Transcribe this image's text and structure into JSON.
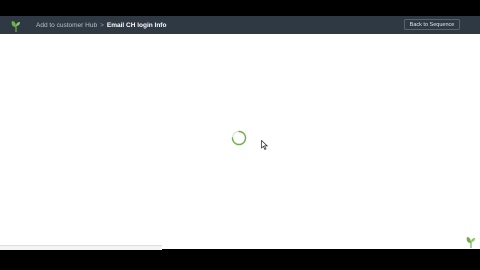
{
  "header": {
    "logo_icon": "sprout-icon",
    "breadcrumb_parent": "Add to customer Hub",
    "breadcrumb_separator": ">",
    "breadcrumb_current": "Email CH login Info",
    "back_button_label": "Back to Sequence"
  },
  "main": {
    "state": "loading",
    "spinner_icon": "loading-spinner-icon",
    "cursor_icon": "mouse-pointer-icon",
    "corner_icon": "sprout-icon"
  },
  "colors": {
    "header_bg": "#2f3944",
    "accent_green": "#6fb04b",
    "content_bg": "#ffffff"
  }
}
